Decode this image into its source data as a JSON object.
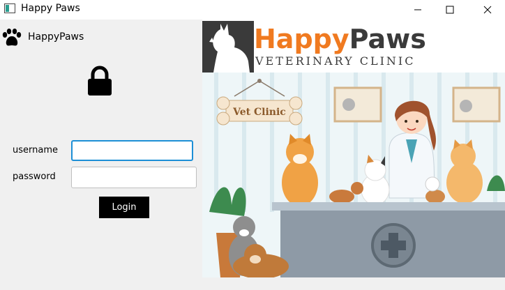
{
  "window": {
    "title": "Happy Paws",
    "controls": [
      "minimize-icon",
      "maximize-icon",
      "close-icon"
    ]
  },
  "sidebar": {
    "brand_icon": "paw-icon",
    "brand_name": "HappyPaws",
    "lock_icon": "lock-icon"
  },
  "login_form": {
    "username_label": "username",
    "username_value": "",
    "password_label": "password",
    "password_value": "",
    "login_button": "Login"
  },
  "banner": {
    "logo_word_1": "Happy",
    "logo_word_2": "Paws",
    "logo_subtitle": "VETERINARY CLINIC",
    "sign_text": "Vet Clinic"
  },
  "colors": {
    "accent_orange": "#f07a20",
    "logo_dark": "#3a3a3a",
    "focus_blue": "#1d8fd6",
    "button_black": "#000000"
  }
}
